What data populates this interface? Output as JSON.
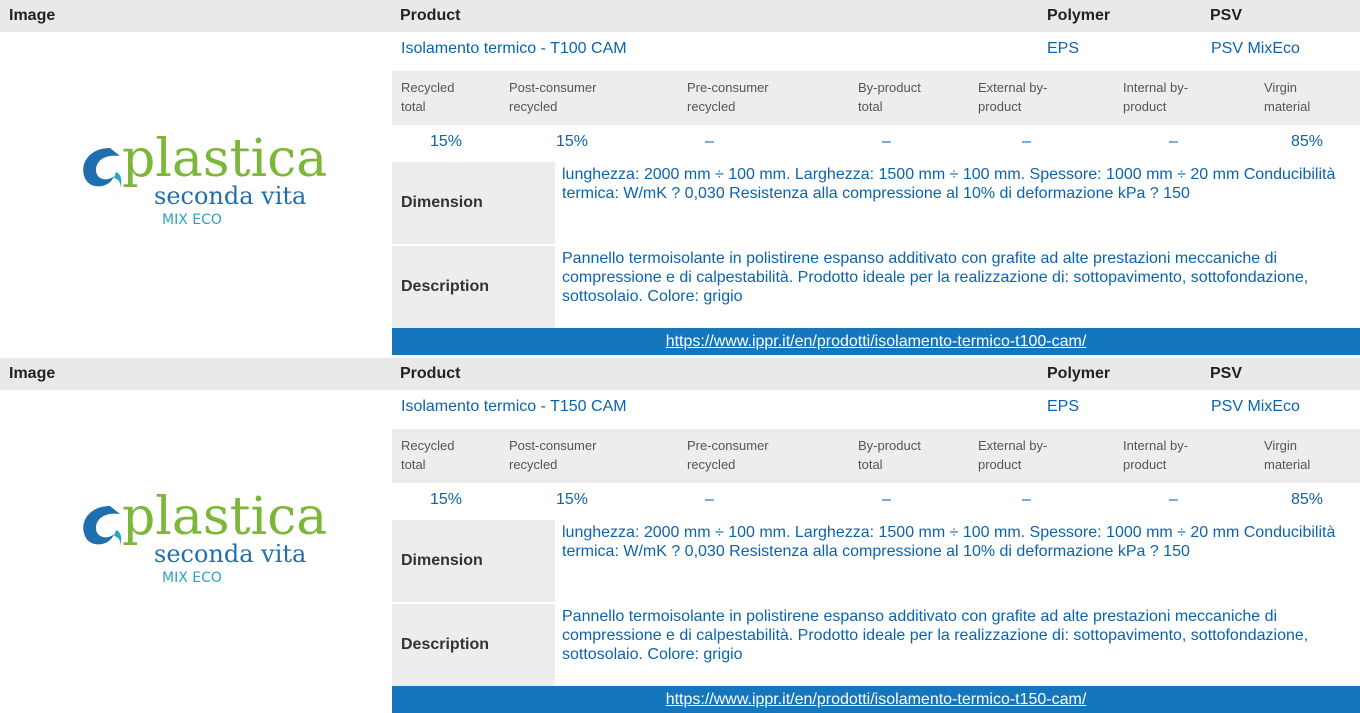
{
  "labels": {
    "image": "Image",
    "product": "Product",
    "polymer": "Polymer",
    "psv": "PSV",
    "dimension": "Dimension",
    "description": "Description"
  },
  "stat_headers": [
    [
      "Recycled",
      "total"
    ],
    [
      "Post-consumer",
      "recycled"
    ],
    [
      "Pre-consumer",
      "recycled"
    ],
    [
      "By-product",
      "total"
    ],
    [
      "External by-",
      "product"
    ],
    [
      "Internal by-",
      "product"
    ],
    [
      "Virgin",
      "material"
    ]
  ],
  "logo": {
    "word": "plastica",
    "line2": "seconda vita",
    "line3": "MIX ECO",
    "colors": {
      "green": "#7db73a",
      "blue": "#1f6fb0",
      "teal": "#2aa3c4"
    }
  },
  "colors": {
    "link": "#0b63b0",
    "url_bar": "#1477bd",
    "header_bg": "#e9e9e9"
  },
  "records": [
    {
      "product": "Isolamento termico - T100 CAM",
      "polymer": "EPS",
      "psv": "PSV MixEco",
      "stats": [
        "15%",
        "15%",
        "–",
        "–",
        "–",
        "–",
        "85%"
      ],
      "dimension": "lunghezza: 2000 mm ÷ 100 mm. Larghezza: 1500 mm ÷ 100 mm. Spessore: 1000 mm ÷ 20 mm Conducibilità termica: W/mK ? 0,030 Resistenza alla compressione al 10% di deformazione kPa ? 150",
      "description": "Pannello termoisolante in polistirene espanso additivato con grafite ad alte prestazioni meccaniche di compressione e di calpestabilità. Prodotto ideale per la realizzazione di: sottopavimento, sottofondazione, sottosolaio. Colore: grigio",
      "url": "https://www.ippr.it/en/prodotti/isolamento-termico-t100-cam/"
    },
    {
      "product": "Isolamento termico - T150 CAM",
      "polymer": "EPS",
      "psv": "PSV MixEco",
      "stats": [
        "15%",
        "15%",
        "–",
        "–",
        "–",
        "–",
        "85%"
      ],
      "dimension": "lunghezza: 2000 mm ÷ 100 mm. Larghezza: 1500 mm ÷ 100 mm. Spessore: 1000 mm ÷ 20 mm Conducibilità termica: W/mK ? 0,030 Resistenza alla compressione al 10% di deformazione kPa ? 150",
      "description": "Pannello termoisolante in polistirene espanso additivato con grafite ad alte prestazioni meccaniche di compressione e di calpestabilità. Prodotto ideale per la realizzazione di: sottopavimento, sottofondazione, sottosolaio. Colore: grigio",
      "url": "https://www.ippr.it/en/prodotti/isolamento-termico-t150-cam/"
    }
  ]
}
